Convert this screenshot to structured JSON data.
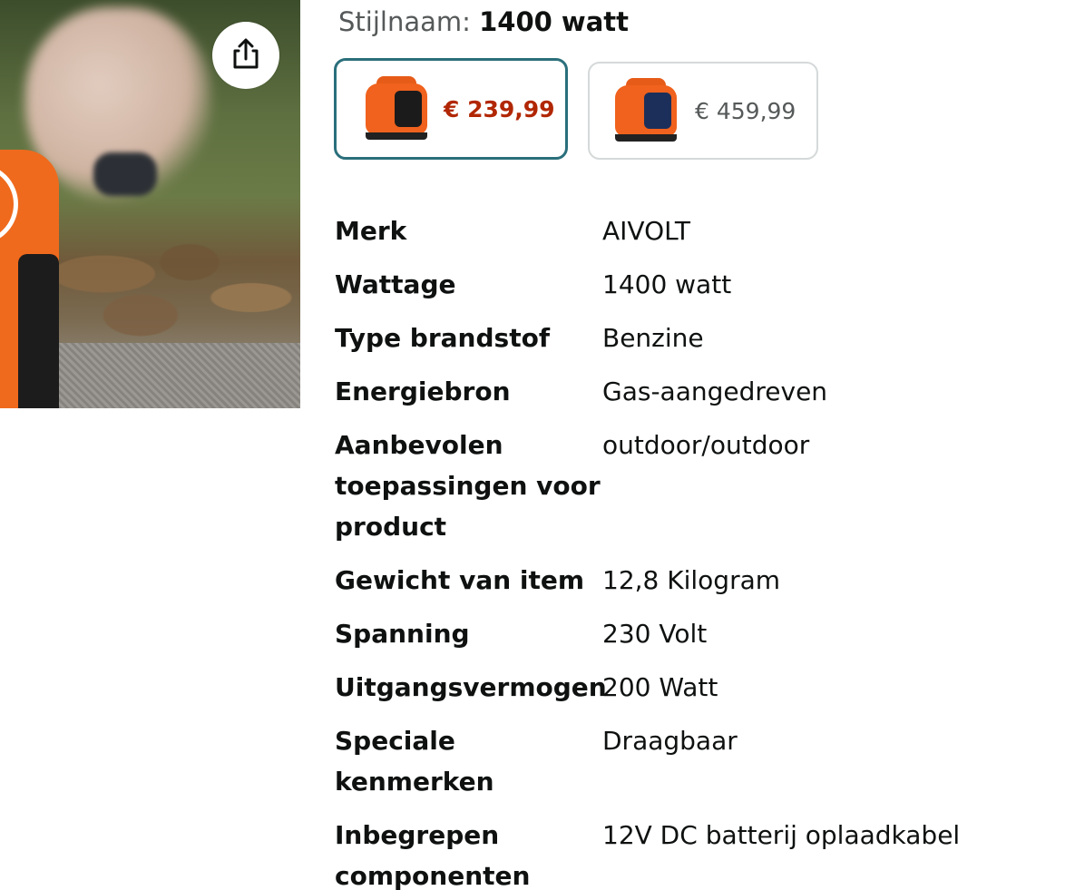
{
  "style": {
    "label": "Stijlnaam:",
    "value": "1400 watt"
  },
  "options": [
    {
      "price": "€ 239,99",
      "selected": true
    },
    {
      "price": "€ 459,99",
      "selected": false
    }
  ],
  "icons": {
    "share": "share-icon"
  },
  "colors": {
    "selected_border": "#2a6f7b",
    "price_red": "#b12704",
    "muted_text": "#565959"
  },
  "specs": [
    {
      "key": "Merk",
      "value": "AIVOLT"
    },
    {
      "key": "Wattage",
      "value": "1400 watt"
    },
    {
      "key": "Type brandstof",
      "value": "Benzine"
    },
    {
      "key": "Energiebron",
      "value": "Gas-aangedreven"
    },
    {
      "key": "Aanbevolen toepassingen voor product",
      "value": "outdoor/outdoor"
    },
    {
      "key": "Gewicht van item",
      "value": "12,8 Kilogram"
    },
    {
      "key": "Spanning",
      "value": "230 Volt"
    },
    {
      "key": "Uitgangsvermogen",
      "value": "200 Watt"
    },
    {
      "key": "Speciale kenmerken",
      "value": "Draagbaar"
    },
    {
      "key": "Inbegrepen componenten",
      "value": "12V DC batterij oplaadkabel"
    }
  ]
}
